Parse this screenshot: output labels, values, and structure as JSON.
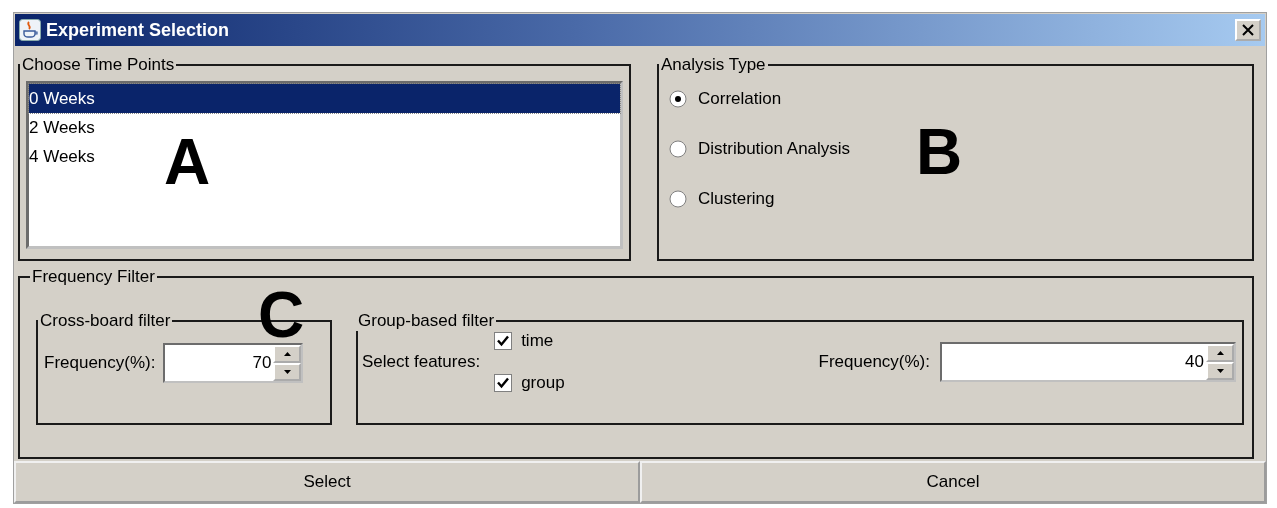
{
  "window": {
    "title": "Experiment Selection"
  },
  "time_points": {
    "title": "Choose Time Points",
    "items": [
      {
        "label": "0 Weeks",
        "selected": true
      },
      {
        "label": "2 Weeks",
        "selected": false
      },
      {
        "label": "4 Weeks",
        "selected": false
      }
    ]
  },
  "analysis_type": {
    "title": "Analysis Type",
    "options": [
      {
        "label": "Correlation",
        "selected": true
      },
      {
        "label": "Distribution Analysis",
        "selected": false
      },
      {
        "label": "Clustering",
        "selected": false
      }
    ]
  },
  "frequency_filter": {
    "title": "Frequency Filter",
    "cross_board": {
      "title": "Cross-board filter",
      "label": "Frequency(%):",
      "value": "70"
    },
    "group_based": {
      "title": "Group-based filter",
      "features_label": "Select features:",
      "features": [
        {
          "label": "time",
          "checked": true
        },
        {
          "label": "group",
          "checked": true
        }
      ],
      "label": "Frequency(%):",
      "value": "40"
    }
  },
  "buttons": [
    "Select",
    "Cancel"
  ],
  "annotations": [
    "A",
    "B",
    "C"
  ]
}
